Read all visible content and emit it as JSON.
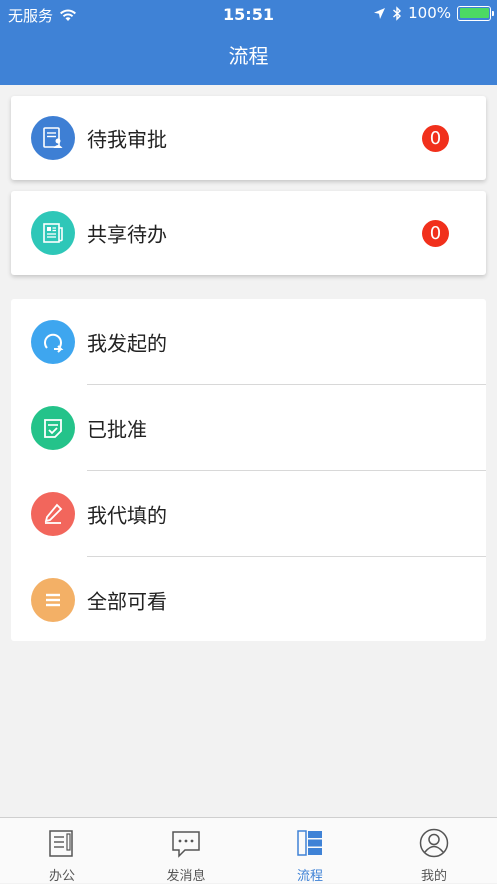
{
  "status_bar": {
    "carrier": "无服务",
    "time": "15:51",
    "battery": "100%"
  },
  "header": {
    "title": "流程"
  },
  "cards": [
    {
      "label": "待我审批",
      "badge": "0",
      "icon": "approval-doc-icon",
      "color": "#3e7fd4"
    },
    {
      "label": "共享待办",
      "badge": "0",
      "icon": "newspaper-icon",
      "color": "#2ec7b8"
    }
  ],
  "list_items": [
    {
      "label": "我发起的",
      "icon": "initiated-arrow-icon",
      "color": "#3ea6ef"
    },
    {
      "label": "已批准",
      "icon": "approved-check-icon",
      "color": "#24c38a"
    },
    {
      "label": "我代填的",
      "icon": "pencil-icon",
      "color": "#f2665c"
    },
    {
      "label": "全部可看",
      "icon": "list-icon",
      "color": "#f3b066"
    }
  ],
  "tabs": [
    {
      "label": "办公",
      "icon": "office-doc-icon",
      "active": false
    },
    {
      "label": "发消息",
      "icon": "message-bubble-icon",
      "active": false
    },
    {
      "label": "流程",
      "icon": "process-icon",
      "active": true
    },
    {
      "label": "我的",
      "icon": "profile-icon",
      "active": false
    }
  ],
  "colors": {
    "accent": "#3f82d6",
    "badge": "#f1301c"
  }
}
